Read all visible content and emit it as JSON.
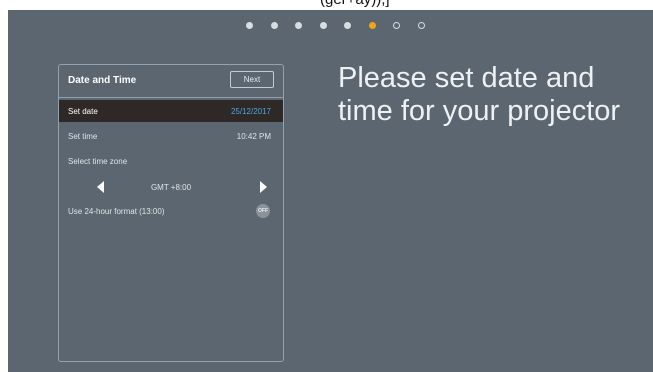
{
  "top_fragment": "(ger+ay)),]",
  "progress": {
    "total": 8,
    "completed": 5,
    "current_index": 5
  },
  "colors": {
    "background": "#5b6670",
    "accent": "#f0a31c",
    "value_blue": "#4aa8e0",
    "selected_row": "#2e2926"
  },
  "panel": {
    "title": "Date and Time",
    "next_label": "Next",
    "rows": {
      "set_date": {
        "label": "Set date",
        "value": "25/12/2017"
      },
      "set_time": {
        "label": "Set time",
        "value": "10:42 PM"
      },
      "time_zone": {
        "label": "Select time zone",
        "value": "GMT +8:00"
      },
      "format_24h": {
        "label": "Use 24-hour format (13:00)",
        "toggle": "OFF"
      }
    },
    "icons": {
      "prev": "arrow-left-icon",
      "next": "arrow-right-icon"
    }
  },
  "prompt_text": "Please set date and time for your projector"
}
